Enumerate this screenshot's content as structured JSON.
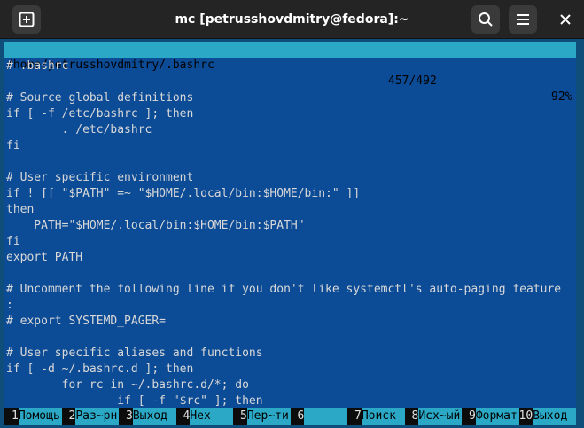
{
  "window": {
    "title": "mc [petrusshovdmitry@fedora]:~",
    "buttons": {
      "new_tab_icon": "plus-in-square-icon",
      "search_icon": "search-icon",
      "menu_icon": "hamburger-menu-icon",
      "close_icon": "close-icon"
    }
  },
  "status": {
    "path": "/home/petrusshovdmitry/.bashrc",
    "lines": "457/492",
    "percent": "92%"
  },
  "content": {
    "lines": [
      "# .bashrc",
      "",
      "# Source global definitions",
      "if [ -f /etc/bashrc ]; then",
      "        . /etc/bashrc",
      "fi",
      "",
      "# User specific environment",
      "if ! [[ \"$PATH\" =~ \"$HOME/.local/bin:$HOME/bin:\" ]]",
      "then",
      "    PATH=\"$HOME/.local/bin:$HOME/bin:$PATH\"",
      "fi",
      "export PATH",
      "",
      "# Uncomment the following line if you don't like systemctl's auto-paging feature",
      ":",
      "# export SYSTEMD_PAGER=",
      "",
      "# User specific aliases and functions",
      "if [ -d ~/.bashrc.d ]; then",
      "        for rc in ~/.bashrc.d/*; do",
      "                if [ -f \"$rc\" ]; then"
    ]
  },
  "fkeys": [
    {
      "num": "1",
      "label": "Помощь"
    },
    {
      "num": "2",
      "label": "Раз~рн"
    },
    {
      "num": "3",
      "label": "Выход"
    },
    {
      "num": "4",
      "label": "Hex"
    },
    {
      "num": "5",
      "label": "Пер~ти"
    },
    {
      "num": "6",
      "label": ""
    },
    {
      "num": "7",
      "label": "Поиск"
    },
    {
      "num": "8",
      "label": "Исх~ый"
    },
    {
      "num": "9",
      "label": "Формат"
    },
    {
      "num": "10",
      "label": "Выход"
    }
  ],
  "colors": {
    "background": "#0c4b96",
    "status_bar": "#2aa8c6",
    "text": "#d8d8d8"
  }
}
